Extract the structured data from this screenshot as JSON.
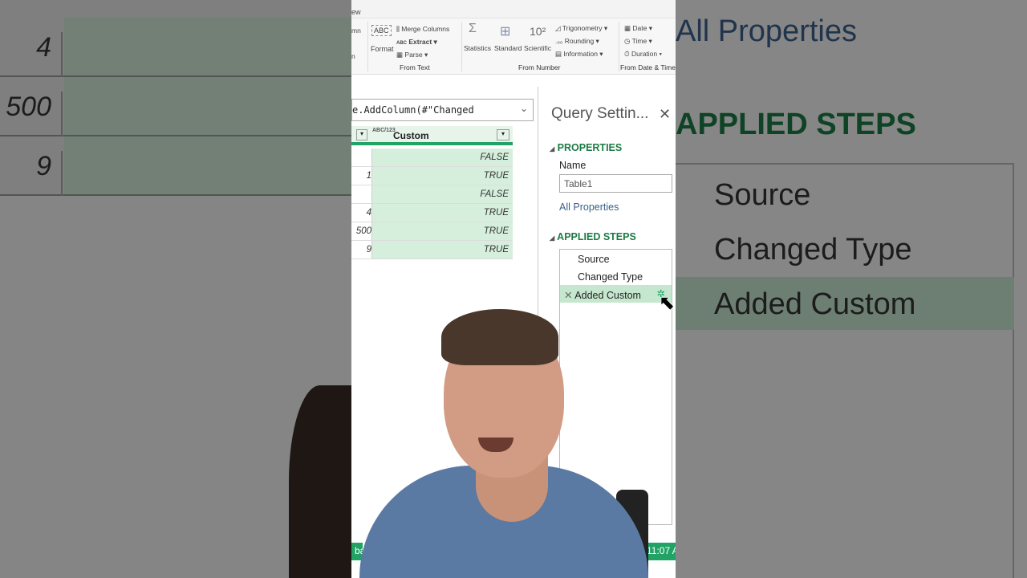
{
  "background_left": {
    "values": [
      "4",
      "500",
      "9"
    ]
  },
  "background_right": {
    "all_properties": "All Properties",
    "applied_steps": "APPLIED STEPS",
    "steps": [
      "Source",
      "Changed Type",
      "Added Custom"
    ]
  },
  "ribbon": {
    "tab_partial": "ew",
    "left_partial": [
      "mn",
      "n"
    ],
    "format": "Format",
    "merge_columns": "Merge Columns",
    "extract": "Extract ▾",
    "parse": "Parse ▾",
    "statistics": "Statistics",
    "standard": "Standard",
    "scientific": "Scientific",
    "trigonometry": "Trigonometry ▾",
    "rounding": "Rounding ▾",
    "information": "Information ▾",
    "date": "Date ▾",
    "time": "Time ▾",
    "duration": "Duration ▾",
    "groups": {
      "from_text": "From Text",
      "from_number": "From Number",
      "from_date_time": "From Date & Time"
    }
  },
  "formula_bar": {
    "text": "e.AddColumn(#\"Changed"
  },
  "grid": {
    "column_header": "Custom",
    "type_icon": "ABC/123",
    "rows": [
      {
        "c1": "",
        "custom": "FALSE"
      },
      {
        "c1": "1",
        "custom": "TRUE"
      },
      {
        "c1": "",
        "custom": "FALSE"
      },
      {
        "c1": "4",
        "custom": "TRUE"
      },
      {
        "c1": "500",
        "custom": "TRUE"
      },
      {
        "c1": "9",
        "custom": "TRUE"
      }
    ]
  },
  "query_settings": {
    "title": "Query Settin...",
    "properties": "PROPERTIES",
    "name_label": "Name",
    "name_value": "Table1",
    "all_properties": "All Properties",
    "applied_steps": "APPLIED STEPS",
    "steps": [
      "Source",
      "Changed Type",
      "Added Custom"
    ],
    "selected_step": 2
  },
  "status_bar": {
    "left": "ba",
    "right": "11:07 A"
  },
  "colors": {
    "accent": "#21a366",
    "section": "#1d7a45",
    "selected_step": "#c6e7cf"
  }
}
